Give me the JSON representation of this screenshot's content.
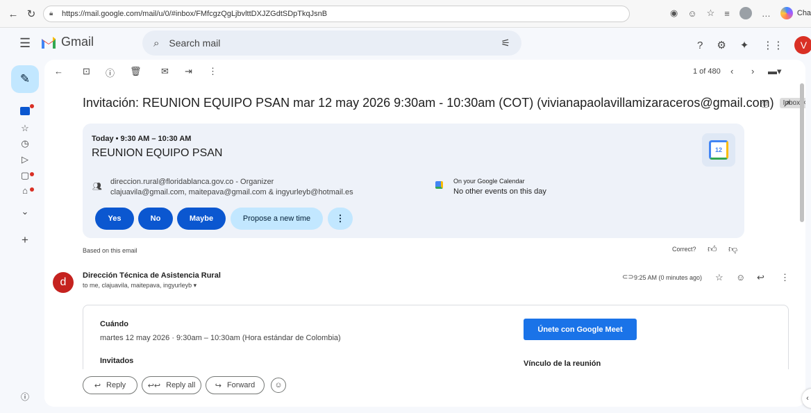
{
  "browser": {
    "url": "https://mail.google.com/mail/u/0/#inbox/FMfcgzQgLjbvlttDXJZGdtSDpTkqJsnB",
    "chat_label": "Chat"
  },
  "header": {
    "app_name": "Gmail",
    "search_placeholder": "Search mail",
    "avatar_letter": "V"
  },
  "toolbar": {
    "pager": "1 of 480"
  },
  "email": {
    "subject": "Invitación: REUNION EQUIPO PSAN mar 12 may 2026 9:30am - 10:30am (COT) (vivianapaolavillamizaraceros@gmail.com)",
    "label_chip": "Inbox ×"
  },
  "event": {
    "when": "Today • 9:30 AM – 10:30 AM",
    "title": "REUNION EQUIPO PSAN",
    "calendar_day": "12",
    "organizer": "direccion.rural@floridablanca.gov.co - Organizer",
    "guests": "clajuavila@gmail.com, maitepava@gmail.com & ingyurleyb@hotmail.es",
    "gcal_title": "On your Google Calendar",
    "gcal_sub": "No other events on this day",
    "rsvp": {
      "yes": "Yes",
      "no": "No",
      "maybe": "Maybe",
      "propose": "Propose a new time",
      "more": "⋮"
    }
  },
  "feedback": {
    "based": "Based on this email",
    "correct": "Correct?"
  },
  "message": {
    "avatar_letter": "d",
    "sender": "Dirección Técnica de Asistencia Rural",
    "to": "to me, clajuavila, maitepava, ingyurleyb ▾",
    "time": "9:25 AM (0 minutes ago)"
  },
  "invite": {
    "when_label": "Cuándo",
    "when_value": "martes 12 may 2026 · 9:30am – 10:30am (Hora estándar de Colombia)",
    "guests_label": "Invitados",
    "meet_button": "Únete con Google Meet",
    "link_label": "Vínculo de la reunión"
  },
  "reply_bar": {
    "reply": "Reply",
    "reply_all": "Reply all",
    "forward": "Forward"
  }
}
